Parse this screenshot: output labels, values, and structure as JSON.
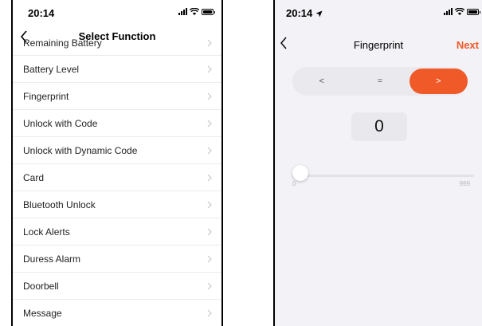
{
  "left_screen": {
    "status_time": "20:14",
    "nav_title": "Select Function",
    "items": [
      {
        "label": "Remaining Battery"
      },
      {
        "label": "Battery Level"
      },
      {
        "label": "Fingerprint"
      },
      {
        "label": "Unlock with Code"
      },
      {
        "label": "Unlock with Dynamic Code"
      },
      {
        "label": "Card"
      },
      {
        "label": "Bluetooth Unlock"
      },
      {
        "label": "Lock Alerts"
      },
      {
        "label": "Duress Alarm"
      },
      {
        "label": "Doorbell"
      },
      {
        "label": "Message"
      }
    ]
  },
  "right_screen": {
    "status_time": "20:14",
    "nav_title": "Fingerprint",
    "next_label": "Next",
    "segments": [
      "<",
      "=",
      ">"
    ],
    "selected_segment": ">",
    "value_display": "0",
    "slider": {
      "value": 0,
      "min_label": "0",
      "max_label": "999"
    }
  },
  "colors": {
    "accent": "#f05a28",
    "segment_bg": "#e9e9ee",
    "screen_bg": "#f2f2f7"
  },
  "icons": [
    "signal-icon",
    "wifi-icon",
    "battery-icon",
    "location-arrow-icon",
    "back-icon",
    "chevron-right-icon"
  ]
}
